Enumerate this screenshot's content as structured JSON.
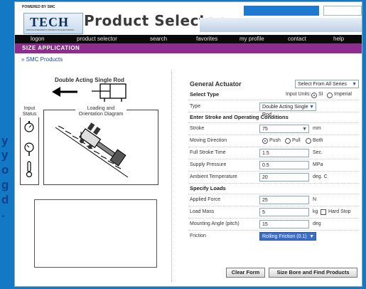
{
  "left_edge_letters": [
    "y",
    "y",
    "o",
    "g",
    "d",
    "."
  ],
  "header": {
    "powered_by": "POWERED BY SMC",
    "logo_text": "TECH",
    "logo_subtext": "DIGITAL PNEUMATIC PRODUCTS ELECTRONIC",
    "product_title": "Product Selector"
  },
  "nav": {
    "items": [
      "logon",
      "product selector",
      "search",
      "favorites",
      "my profile",
      "contact",
      "help"
    ]
  },
  "section_title": "SIZE APPLICATION",
  "breadcrumb": "» SMC Products",
  "diagram": {
    "title": "Double Acting Single Rod",
    "input_status_label": "Input Status",
    "loading_label": "Loading and Orientation Diagram"
  },
  "form": {
    "general_actuator_label": "General Actuator",
    "series_select": "Select From All Series",
    "select_type_label": "Select Type",
    "input_units_label": "Input Units:",
    "unit_si": "SI",
    "unit_imperial": "Imperial",
    "unit_selected": "SI",
    "type_label": "Type",
    "type_value": "Double Acting Single Rod",
    "stroke_section": "Enter Stroke and Operating Conditions",
    "stroke_label": "Stroke",
    "stroke_value": "75",
    "stroke_unit": "mm",
    "moving_direction_label": "Moving Direction",
    "dir_push": "Push",
    "dir_pull": "Pull",
    "dir_both": "Both",
    "direction_selected": "Push",
    "full_stroke_label": "Full Stroke Time",
    "full_stroke_value": "1.5",
    "full_stroke_unit": "Sec.",
    "supply_label": "Supply Pressure",
    "supply_value": "0.5",
    "supply_unit": "MPa",
    "ambient_label": "Ambient Temperature",
    "ambient_value": "20",
    "ambient_unit": "deg. C",
    "loads_section": "Specify Loads",
    "applied_force_label": "Applied Force",
    "applied_force_value": "25",
    "applied_force_unit": "N",
    "load_mass_label": "Load Mass",
    "load_mass_value": "5",
    "load_mass_unit": "kg",
    "hard_stop_label": "Hard Stop",
    "mounting_label": "Mounting Angle (pitch)",
    "mounting_value": "15",
    "mounting_unit": "deg",
    "friction_label": "Friction",
    "friction_value": "Rolling Friction (0.1)"
  },
  "buttons": {
    "clear": "Clear Form",
    "size": "Size Bore and Find Products"
  },
  "colors": {
    "frame_blue": "#1479c4",
    "section_purple": "#8d2e8e",
    "nav_black": "#0a0a0a",
    "accent_blue": "#1d7ad0"
  }
}
